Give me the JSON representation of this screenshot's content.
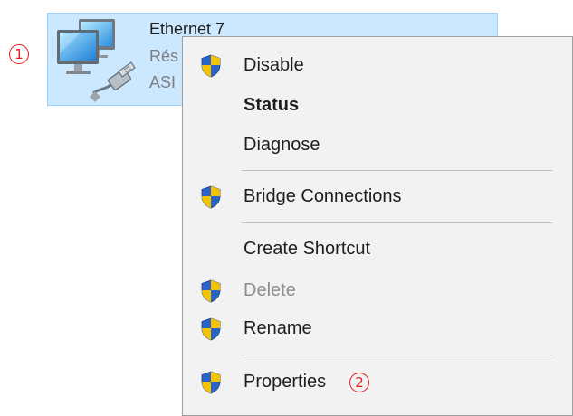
{
  "markers": {
    "step1": "1",
    "step2": "2"
  },
  "adapter": {
    "name": "Ethernet 7",
    "status": "Rés",
    "device": "ASI",
    "icon": "network-adapter-icon"
  },
  "menu": {
    "items": [
      {
        "label": "Disable",
        "icon": "uac-shield-icon",
        "bold": false,
        "enabled": true
      },
      {
        "label": "Status",
        "icon": null,
        "bold": true,
        "enabled": true
      },
      {
        "label": "Diagnose",
        "icon": null,
        "bold": false,
        "enabled": true
      },
      {
        "label": "Bridge Connections",
        "icon": "uac-shield-icon",
        "bold": false,
        "enabled": true
      },
      {
        "label": "Create Shortcut",
        "icon": null,
        "bold": false,
        "enabled": true
      },
      {
        "label": "Delete",
        "icon": "uac-shield-icon",
        "bold": false,
        "enabled": false
      },
      {
        "label": "Rename",
        "icon": "uac-shield-icon",
        "bold": false,
        "enabled": true
      },
      {
        "label": "Properties",
        "icon": "uac-shield-icon",
        "bold": false,
        "enabled": true
      }
    ]
  },
  "colors": {
    "selection": "#cce8ff",
    "selection_border": "#99d1ff",
    "menu_background": "#f2f2f2",
    "marker": "#e81c1c",
    "shield_blue": "#2a63c9",
    "shield_yellow": "#f5c400"
  }
}
